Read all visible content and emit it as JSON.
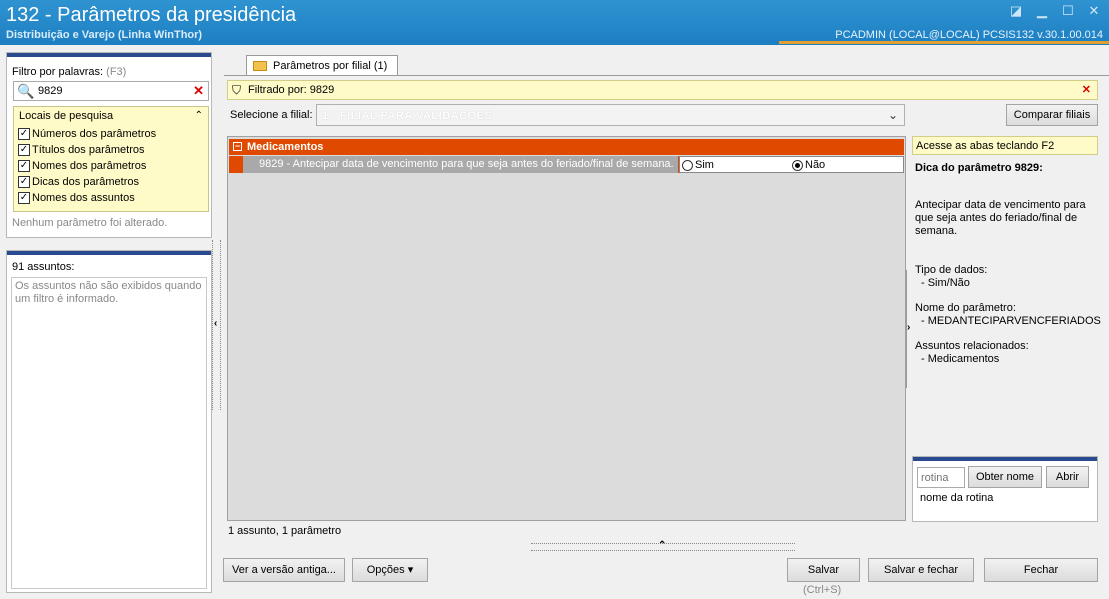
{
  "window": {
    "title": "132 - Parâmetros da presidência",
    "subtitle": "Distribuição e Varejo (Linha WinThor)",
    "user_info": "PCADMIN (LOCAL@LOCAL)   PCSIS132  v.30.1.00.014"
  },
  "sidebar": {
    "filter_label": "Filtro por palavras:",
    "filter_hint": "(F3)",
    "search_value": "9829",
    "locais_title": "Locais de pesquisa",
    "locais": [
      {
        "label": "Números dos parâmetros",
        "checked": true
      },
      {
        "label": "Títulos dos parâmetros",
        "checked": true
      },
      {
        "label": "Nomes dos parâmetros",
        "checked": true
      },
      {
        "label": "Dicas dos parâmetros",
        "checked": true
      },
      {
        "label": "Nomes dos assuntos",
        "checked": true
      }
    ],
    "status": "Nenhum parâmetro foi alterado.",
    "assuntos_label": "91 assuntos:",
    "assuntos_note": "Os assuntos não são exibidos quando um filtro é informado."
  },
  "tab": {
    "label": "Parâmetros por filial  (1)"
  },
  "filter_bar": {
    "text": "Filtrado por: 9829"
  },
  "branch": {
    "label": "Selecione a filial:",
    "value": "1 - FILIAL PARA VALIDACOES",
    "compare_label": "Comparar filiais"
  },
  "grid": {
    "group": "Medicamentos",
    "row_text": "9829 - Antecipar data de vencimento para que seja antes do feriado/final de semana.",
    "option_yes": "Sim",
    "option_no": "Não",
    "selected": "Não"
  },
  "grid_status": "1 assunto, 1 parâmetro",
  "right_panel": {
    "hint": "Acesse as abas teclando F2",
    "tip_title": "Dica do parâmetro 9829:",
    "tip_text": "Antecipar data de vencimento para que seja antes do feriado/final de semana.",
    "type_label": "Tipo de dados:",
    "type_value": "- Sim/Não",
    "name_label": "Nome do parâmetro:",
    "name_value": "- MEDANTECIPARVENCFERIADOS",
    "subjects_label": "Assuntos relacionados:",
    "subjects_value": "- Medicamentos"
  },
  "rotina": {
    "placeholder": "rotina",
    "obter_label": "Obter nome",
    "abrir_label": "Abrir",
    "nome_label": "nome da rotina"
  },
  "footer": {
    "ver_label": "Ver a versão antiga...",
    "opcoes_label": "Opções",
    "salvar_label": "Salvar",
    "salvar_shortcut": "(Ctrl+S)",
    "salvar_fechar_label": "Salvar e fechar",
    "fechar_label": "Fechar"
  }
}
